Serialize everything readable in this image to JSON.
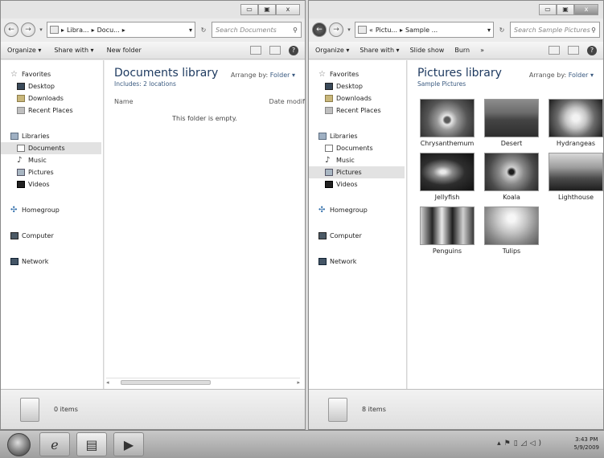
{
  "left_window": {
    "caption": {
      "minimize": "▭",
      "maximize": "▣",
      "close": "x"
    },
    "address": {
      "crumbs": [
        "Libra...",
        "Docu..."
      ]
    },
    "search_placeholder": "Search Documents",
    "toolbar": {
      "organize": "Organize ▾",
      "share_with": "Share with ▾",
      "new_folder": "New folder"
    },
    "nav": {
      "favorites": "Favorites",
      "desktop": "Desktop",
      "downloads": "Downloads",
      "recent_places": "Recent Places",
      "libraries": "Libraries",
      "documents": "Documents",
      "music": "Music",
      "pictures": "Pictures",
      "videos": "Videos",
      "homegroup": "Homegroup",
      "computer": "Computer",
      "network": "Network"
    },
    "library": {
      "title": "Documents library",
      "subtitle": "Includes: 2 locations",
      "arrange_label": "Arrange by:",
      "arrange_value": "Folder ▾"
    },
    "columns": {
      "name": "Name",
      "date_modified": "Date modif"
    },
    "empty_text": "This folder is empty.",
    "status_text": "0 items"
  },
  "right_window": {
    "caption": {
      "minimize": "▭",
      "maximize": "▣",
      "close": "x"
    },
    "address": {
      "prefix": "«",
      "crumbs": [
        "Pictu...",
        "Sample ..."
      ]
    },
    "search_placeholder": "Search Sample Pictures",
    "toolbar": {
      "organize": "Organize ▾",
      "share_with": "Share with ▾",
      "slide_show": "Slide show",
      "burn": "Burn",
      "more": "»"
    },
    "nav": {
      "favorites": "Favorites",
      "desktop": "Desktop",
      "downloads": "Downloads",
      "recent_places": "Recent Places",
      "libraries": "Libraries",
      "documents": "Documents",
      "music": "Music",
      "pictures": "Pictures",
      "videos": "Videos",
      "homegroup": "Homegroup",
      "computer": "Computer",
      "network": "Network"
    },
    "library": {
      "title": "Pictures library",
      "subtitle": "Sample Pictures",
      "arrange_label": "Arrange by:",
      "arrange_value": "Folder ▾"
    },
    "pictures": [
      "Chrysanthemum",
      "Desert",
      "Hydrangeas",
      "Jellyfish",
      "Koala",
      "Lighthouse",
      "Penguins",
      "Tulips"
    ],
    "status_text": "8 items"
  },
  "taskbar": {
    "clock_time": "3:43 PM",
    "clock_date": "5/9/2009",
    "tray_icons": [
      "arrow-up-icon",
      "flag-icon",
      "power-icon",
      "network-icon",
      "speaker-icon"
    ]
  }
}
